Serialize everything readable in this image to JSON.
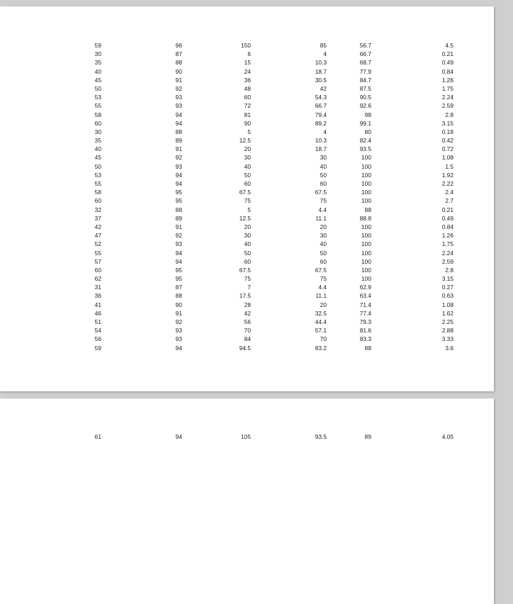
{
  "pages": [
    {
      "rows": [
        [
          "59",
          "96",
          "150",
          "85",
          "56.7",
          "4.5"
        ],
        [
          "30",
          "87",
          "6",
          "4",
          "66.7",
          "0.21"
        ],
        [
          "35",
          "88",
          "15",
          "10.3",
          "68.7",
          "0.49"
        ],
        [
          "40",
          "90",
          "24",
          "18.7",
          "77.9",
          "0.84"
        ],
        [
          "45",
          "91",
          "36",
          "30.5",
          "84.7",
          "1.26"
        ],
        [
          "50",
          "92",
          "48",
          "42",
          "87.5",
          "1.75"
        ],
        [
          "53",
          "93",
          "60",
          "54.3",
          "90.5",
          "2.24"
        ],
        [
          "55",
          "93",
          "72",
          "66.7",
          "92.6",
          "2.59"
        ],
        [
          "58",
          "94",
          "81",
          "79.4",
          "98",
          "2.8"
        ],
        [
          "60",
          "94",
          "90",
          "89.2",
          "99.1",
          "3.15"
        ],
        [
          "30",
          "88",
          "5",
          "4",
          "80",
          "0.18"
        ],
        [
          "35",
          "89",
          "12.5",
          "10.3",
          "82.4",
          "0.42"
        ],
        [
          "40",
          "91",
          "20",
          "18.7",
          "93.5",
          "0.72"
        ],
        [
          "45",
          "92",
          "30",
          "30",
          "100",
          "1.08"
        ],
        [
          "50",
          "93",
          "40",
          "40",
          "100",
          "1.5"
        ],
        [
          "53",
          "94",
          "50",
          "50",
          "100",
          "1.92"
        ],
        [
          "55",
          "94",
          "60",
          "60",
          "100",
          "2.22"
        ],
        [
          "58",
          "95",
          "67.5",
          "67.5",
          "100",
          "2.4"
        ],
        [
          "60",
          "95",
          "75",
          "75",
          "100",
          "2.7"
        ],
        [
          "32",
          "88",
          "5",
          "4.4",
          "88",
          "0.21"
        ],
        [
          "37",
          "89",
          "12.5",
          "11.1",
          "88.8",
          "0.49"
        ],
        [
          "42",
          "91",
          "20",
          "20",
          "100",
          "0.84"
        ],
        [
          "47",
          "92",
          "30",
          "30",
          "100",
          "1.26"
        ],
        [
          "52",
          "93",
          "40",
          "40",
          "100",
          "1.75"
        ],
        [
          "55",
          "94",
          "50",
          "50",
          "100",
          "2.24"
        ],
        [
          "57",
          "94",
          "60",
          "60",
          "100",
          "2.59"
        ],
        [
          "60",
          "95",
          "67.5",
          "67.5",
          "100",
          "2.8"
        ],
        [
          "62",
          "95",
          "75",
          "75",
          "100",
          "3.15"
        ],
        [
          "31",
          "87",
          "7",
          "4.4",
          "62.9",
          "0.27"
        ],
        [
          "36",
          "88",
          "17.5",
          "11.1",
          "63.4",
          "0.63"
        ],
        [
          "41",
          "90",
          "28",
          "20",
          "71.4",
          "1.08"
        ],
        [
          "46",
          "91",
          "42",
          "32.5",
          "77.4",
          "1.62"
        ],
        [
          "51",
          "92",
          "56",
          "44.4",
          "79.3",
          "2.25"
        ],
        [
          "54",
          "93",
          "70",
          "57.1",
          "81.6",
          "2.88"
        ],
        [
          "56",
          "93",
          "84",
          "70",
          "83.3",
          "3.33"
        ],
        [
          "59",
          "94",
          "94.5",
          "83.2",
          "88",
          "3.6"
        ]
      ]
    },
    {
      "rows": [
        [
          "61",
          "94",
          "105",
          "93.5",
          "89",
          "4.05"
        ]
      ]
    }
  ]
}
